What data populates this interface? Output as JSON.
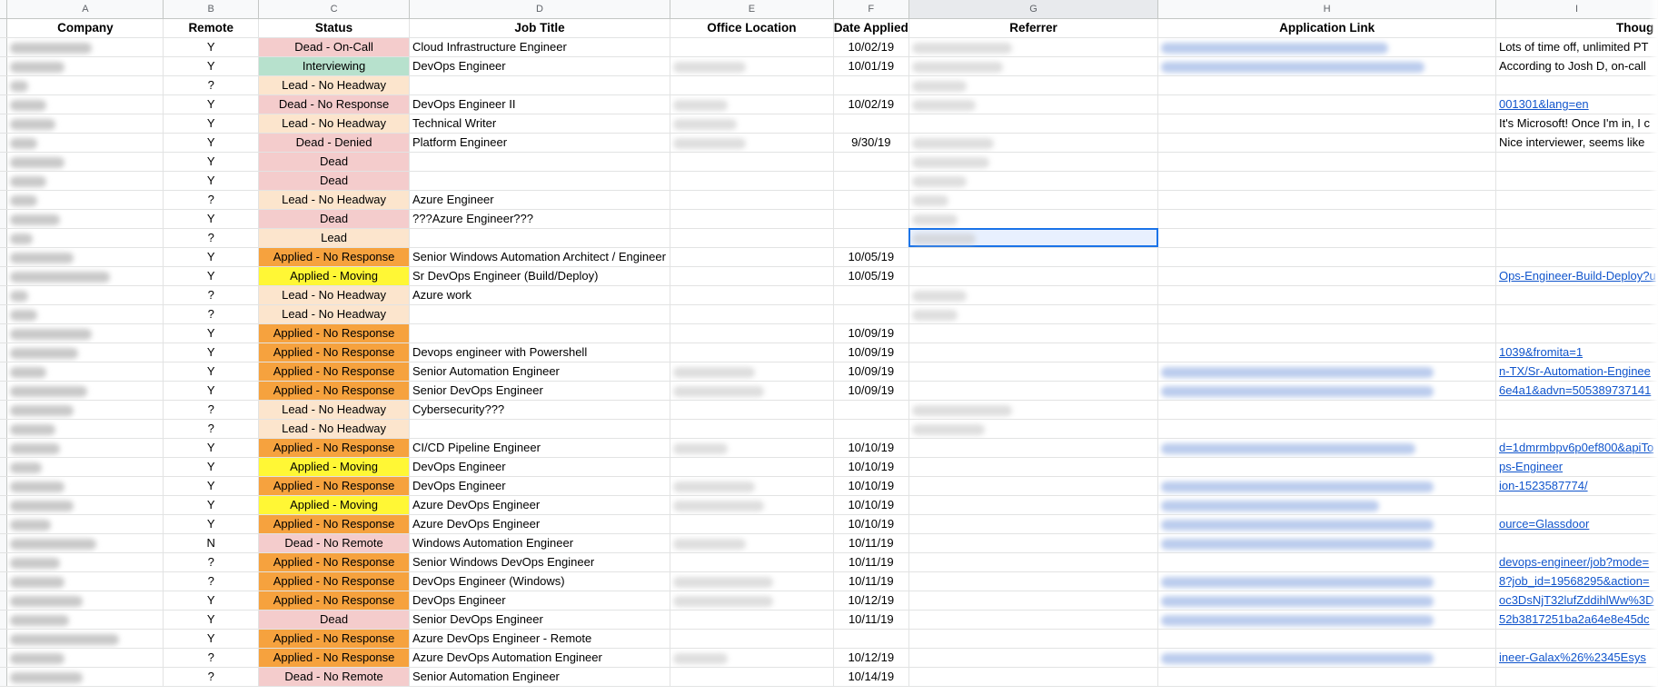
{
  "columns": [
    "A",
    "B",
    "C",
    "D",
    "E",
    "F",
    "G",
    "H",
    "I"
  ],
  "selected_column": "G",
  "headers": {
    "company": "Company",
    "remote": "Remote",
    "status": "Status",
    "job_title": "Job Title",
    "office_location": "Office Location",
    "date_applied": "Date Applied",
    "referrer": "Referrer",
    "application_link": "Application Link",
    "thoughts": "Thoug"
  },
  "status_colors": {
    "Dead": "#f4cccc",
    "Lead": "#fce5cd",
    "Interviewing": "#b7e1cd",
    "Applied - No Response": "#f6a23e",
    "Applied - Moving": "#fff735"
  },
  "rows": [
    {
      "remote": "Y",
      "status": "Dead - On-Call",
      "status_color": "#f4cccc",
      "job": "Cloud Infrastructure Engineer",
      "date": "10/02/19",
      "link": "",
      "thoughts": "Lots of time off, unlimited PT"
    },
    {
      "remote": "Y",
      "status": "Interviewing",
      "status_color": "#b7e1cd",
      "job": "DevOps Engineer",
      "date": "10/01/19",
      "link": "",
      "thoughts": "According to Josh D, on-call"
    },
    {
      "remote": "?",
      "status": "Lead - No Headway",
      "status_color": "#fce5cd",
      "job": "",
      "date": "",
      "link": "",
      "thoughts": ""
    },
    {
      "remote": "Y",
      "status": "Dead - No Response",
      "status_color": "#f4cccc",
      "job": "DevOps Engineer II",
      "date": "10/02/19",
      "link": "001301&lang=en",
      "thoughts": ""
    },
    {
      "remote": "Y",
      "status": "Lead - No Headway",
      "status_color": "#fce5cd",
      "job": "Technical Writer",
      "date": "",
      "link": "",
      "thoughts": "It's Microsoft! Once I'm in, I c"
    },
    {
      "remote": "Y",
      "status": "Dead - Denied",
      "status_color": "#f4cccc",
      "job": "Platform Engineer",
      "date": "9/30/19",
      "link": "",
      "thoughts": "Nice interviewer, seems like"
    },
    {
      "remote": "Y",
      "status": "Dead",
      "status_color": "#f4cccc",
      "job": "",
      "date": "",
      "link": "",
      "thoughts": ""
    },
    {
      "remote": "Y",
      "status": "Dead",
      "status_color": "#f4cccc",
      "job": "",
      "date": "",
      "link": "",
      "thoughts": ""
    },
    {
      "remote": "?",
      "status": "Lead - No Headway",
      "status_color": "#fce5cd",
      "job": "Azure Engineer",
      "date": "",
      "link": "",
      "thoughts": ""
    },
    {
      "remote": "Y",
      "status": "Dead",
      "status_color": "#f4cccc",
      "job": "???Azure Engineer???",
      "date": "",
      "link": "",
      "thoughts": ""
    },
    {
      "remote": "?",
      "status": "Lead",
      "status_color": "#fce5cd",
      "job": "",
      "date": "",
      "link": "",
      "thoughts": ""
    },
    {
      "remote": "Y",
      "status": "Applied - No Response",
      "status_color": "#f6a23e",
      "job": "Senior Windows Automation Architect / Engineer",
      "date": "10/05/19",
      "link": "",
      "thoughts": ""
    },
    {
      "remote": "Y",
      "status": "Applied - Moving",
      "status_color": "#fff735",
      "job": "Sr DevOps Engineer (Build/Deploy)",
      "date": "10/05/19",
      "link": "Ops-Engineer-Build-Deploy?u",
      "thoughts": ""
    },
    {
      "remote": "?",
      "status": "Lead - No Headway",
      "status_color": "#fce5cd",
      "job": "Azure work",
      "date": "",
      "link": "",
      "thoughts": ""
    },
    {
      "remote": "?",
      "status": "Lead - No Headway",
      "status_color": "#fce5cd",
      "job": "",
      "date": "",
      "link": "",
      "thoughts": ""
    },
    {
      "remote": "Y",
      "status": "Applied - No Response",
      "status_color": "#f6a23e",
      "job": "",
      "date": "10/09/19",
      "link": "",
      "thoughts": ""
    },
    {
      "remote": "Y",
      "status": "Applied - No Response",
      "status_color": "#f6a23e",
      "job": "Devops engineer with Powershell",
      "date": "10/09/19",
      "link": "1039&fromita=1",
      "thoughts": ""
    },
    {
      "remote": "Y",
      "status": "Applied - No Response",
      "status_color": "#f6a23e",
      "job": "Senior Automation Engineer",
      "date": "10/09/19",
      "link": "n-TX/Sr-Automation-Enginee",
      "thoughts": ""
    },
    {
      "remote": "Y",
      "status": "Applied - No Response",
      "status_color": "#f6a23e",
      "job": "Senior DevOps Engineer",
      "date": "10/09/19",
      "link": "6e4a1&advn=505389737141",
      "thoughts": ""
    },
    {
      "remote": "?",
      "status": "Lead - No Headway",
      "status_color": "#fce5cd",
      "job": "Cybersecurity???",
      "date": "",
      "link": "",
      "thoughts": ""
    },
    {
      "remote": "?",
      "status": "Lead - No Headway",
      "status_color": "#fce5cd",
      "job": "",
      "date": "",
      "link": "",
      "thoughts": ""
    },
    {
      "remote": "Y",
      "status": "Applied - No Response",
      "status_color": "#f6a23e",
      "job": "CI/CD Pipeline Engineer",
      "date": "10/10/19",
      "link": "d=1dmrmbpv6p0ef800&apiTo",
      "thoughts": ""
    },
    {
      "remote": "Y",
      "status": "Applied - Moving",
      "status_color": "#fff735",
      "job": "DevOps Engineer",
      "date": "10/10/19",
      "link": "ps-Engineer",
      "thoughts": ""
    },
    {
      "remote": "Y",
      "status": "Applied - No Response",
      "status_color": "#f6a23e",
      "job": "DevOps Engineer",
      "date": "10/10/19",
      "link": "ion-1523587774/",
      "thoughts": ""
    },
    {
      "remote": "Y",
      "status": "Applied - Moving",
      "status_color": "#fff735",
      "job": "Azure DevOps Engineer",
      "date": "10/10/19",
      "link": "",
      "thoughts": ""
    },
    {
      "remote": "Y",
      "status": "Applied - No Response",
      "status_color": "#f6a23e",
      "job": "Azure DevOps Engineer",
      "date": "10/10/19",
      "link": "ource=Glassdoor",
      "thoughts": ""
    },
    {
      "remote": "N",
      "status": "Dead - No Remote",
      "status_color": "#f4cccc",
      "job": "Windows Automation Engineer",
      "date": "10/11/19",
      "link": "",
      "thoughts": ""
    },
    {
      "remote": "?",
      "status": "Applied - No Response",
      "status_color": "#f6a23e",
      "job": "Senior Windows DevOps Engineer",
      "date": "10/11/19",
      "link": "devops-engineer/job?mode=",
      "thoughts": ""
    },
    {
      "remote": "?",
      "status": "Applied - No Response",
      "status_color": "#f6a23e",
      "job": "DevOps Engineer (Windows)",
      "date": "10/11/19",
      "link": "8?job_id=19568295&action=",
      "thoughts": ""
    },
    {
      "remote": "Y",
      "status": "Applied - No Response",
      "status_color": "#f6a23e",
      "job": "DevOps Engineer",
      "date": "10/12/19",
      "link": "oc3DsNjT32lufZddihlWw%3D",
      "thoughts": ""
    },
    {
      "remote": "Y",
      "status": "Dead",
      "status_color": "#f4cccc",
      "job": "Senior DevOps Engineer",
      "date": "10/11/19",
      "link": "52b3817251ba2a64e8e45dc",
      "thoughts": ""
    },
    {
      "remote": "Y",
      "status": "Applied - No Response",
      "status_color": "#f6a23e",
      "job": "Azure DevOps Engineer - Remote",
      "date": "",
      "link": "",
      "thoughts": ""
    },
    {
      "remote": "?",
      "status": "Applied - No Response",
      "status_color": "#f6a23e",
      "job": "Azure DevOps Automation Engineer",
      "date": "10/12/19",
      "link": "ineer-Galax%26%2345Esys",
      "thoughts": ""
    },
    {
      "remote": "?",
      "status": "Dead - No Remote",
      "status_color": "#f4cccc",
      "job": "Senior Automation Engineer",
      "date": "10/14/19",
      "link": "",
      "thoughts": ""
    }
  ]
}
